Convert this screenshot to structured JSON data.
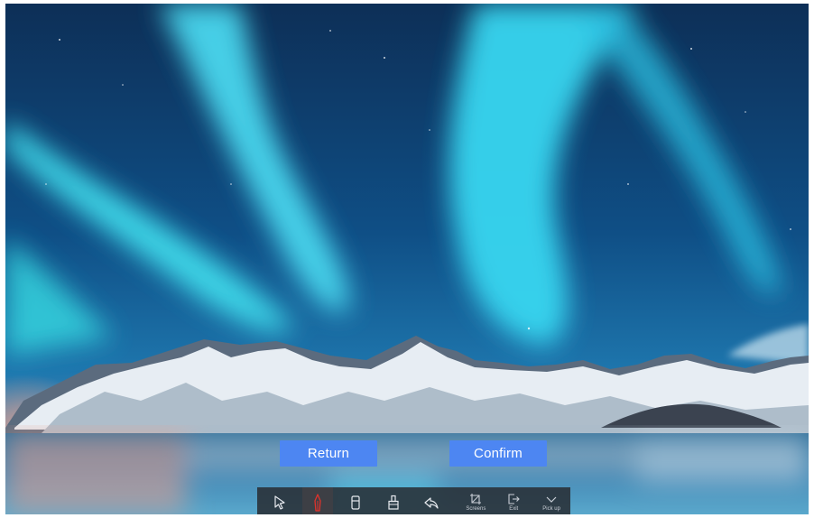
{
  "dialog": {
    "return_label": "Return",
    "confirm_label": "Confirm"
  },
  "toolbar": {
    "tools": [
      {
        "icon": "cursor-arrow-icon",
        "label": ""
      },
      {
        "icon": "pen-icon",
        "label": "",
        "active": true,
        "accent": "#e0322b"
      },
      {
        "icon": "eraser-icon",
        "label": ""
      },
      {
        "icon": "clear-icon",
        "label": ""
      },
      {
        "icon": "undo-icon",
        "label": ""
      },
      {
        "icon": "screenshot-icon",
        "label": "Screens"
      },
      {
        "icon": "exit-icon",
        "label": "Exit"
      },
      {
        "icon": "chevron-down-icon",
        "label": "Pick up"
      }
    ]
  },
  "colors": {
    "button_bg": "#4d86f2",
    "toolbar_bg": "#2b2f35",
    "pen_accent": "#e0322b"
  }
}
